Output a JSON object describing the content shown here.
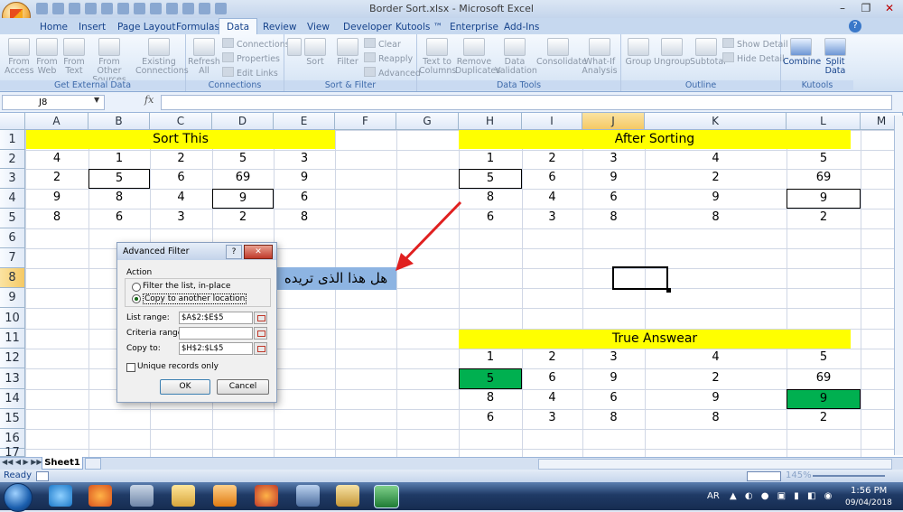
{
  "window": {
    "title": "Border Sort.xlsx - Microsoft Excel"
  },
  "tabs": [
    "Home",
    "Insert",
    "Page Layout",
    "Formulas",
    "Data",
    "Review",
    "View",
    "Developer",
    "Kutools ™",
    "Enterprise",
    "Add-Ins"
  ],
  "ribbon": {
    "get_external": {
      "label": "Get External Data",
      "buttons": [
        "From Access",
        "From Web",
        "From Text",
        "From Other Sources",
        "Existing Connections"
      ]
    },
    "connections": {
      "label": "Connections",
      "refresh": "Refresh All",
      "items": [
        "Connections",
        "Properties",
        "Edit Links"
      ]
    },
    "sort_filter": {
      "label": "Sort & Filter",
      "sort": "Sort",
      "filter": "Filter",
      "items": [
        "Clear",
        "Reapply",
        "Advanced"
      ]
    },
    "data_tools": {
      "label": "Data Tools",
      "buttons": [
        "Text to Columns",
        "Remove Duplicates",
        "Data Validation",
        "Consolidate",
        "What-If Analysis"
      ]
    },
    "outline": {
      "label": "Outline",
      "buttons": [
        "Group",
        "Ungroup",
        "Subtotal"
      ],
      "items": [
        "Show Detail",
        "Hide Detail"
      ]
    },
    "kutools": {
      "label": "Kutools",
      "buttons": [
        "Combine",
        "Split Data"
      ]
    }
  },
  "formula_bar": {
    "name_box": "J8",
    "fx": "fx",
    "formula": ""
  },
  "columns": [
    "A",
    "B",
    "C",
    "D",
    "E",
    "F",
    "G",
    "H",
    "I",
    "J",
    "K",
    "L",
    "M"
  ],
  "rows": [
    "1",
    "2",
    "3",
    "4",
    "5",
    "6",
    "7",
    "8",
    "9",
    "10",
    "11",
    "12",
    "13",
    "14",
    "15",
    "16",
    "17"
  ],
  "sheet": {
    "sort_this_title": "Sort This",
    "after_title": "After Sorting",
    "true_title": "True Answear",
    "arabic_note": "هل هذا الذى تريده",
    "sort_this": [
      [
        "4",
        "1",
        "2",
        "5",
        "3"
      ],
      [
        "2",
        "5",
        "6",
        "69",
        "9"
      ],
      [
        "9",
        "8",
        "4",
        "9",
        "6"
      ],
      [
        "8",
        "6",
        "3",
        "2",
        "8"
      ]
    ],
    "after": [
      [
        "1",
        "2",
        "3",
        "4",
        "5"
      ],
      [
        "5",
        "6",
        "9",
        "2",
        "69"
      ],
      [
        "8",
        "4",
        "6",
        "9",
        "9"
      ],
      [
        "6",
        "3",
        "8",
        "8",
        "2"
      ]
    ],
    "true_answer": [
      [
        "1",
        "2",
        "3",
        "4",
        "5"
      ],
      [
        "5",
        "6",
        "9",
        "2",
        "69"
      ],
      [
        "8",
        "4",
        "6",
        "9",
        "9"
      ],
      [
        "6",
        "3",
        "8",
        "8",
        "2"
      ]
    ]
  },
  "dialog": {
    "title": "Advanced Filter",
    "help": "?",
    "close": "✕",
    "action_label": "Action",
    "opt_filter": "Filter the list, in-place",
    "opt_copy": "Copy to another location",
    "list_range_label": "List range:",
    "list_range": "$A$2:$E$5",
    "criteria_label": "Criteria range:",
    "criteria": "",
    "copy_to_label": "Copy to:",
    "copy_to": "$H$2:$L$5",
    "unique_label": "Unique records only",
    "ok": "OK",
    "cancel": "Cancel"
  },
  "sheet_tab": "Sheet1",
  "status": {
    "ready": "Ready",
    "zoom": "145%"
  },
  "taskbar": {
    "lang": "AR",
    "time": "1:56 PM",
    "date": "09/04/2018"
  },
  "colors": {
    "yellow": "#ffff00",
    "green": "#00b050",
    "arrow": "#e02020",
    "note_bg": "#8db4e2"
  }
}
